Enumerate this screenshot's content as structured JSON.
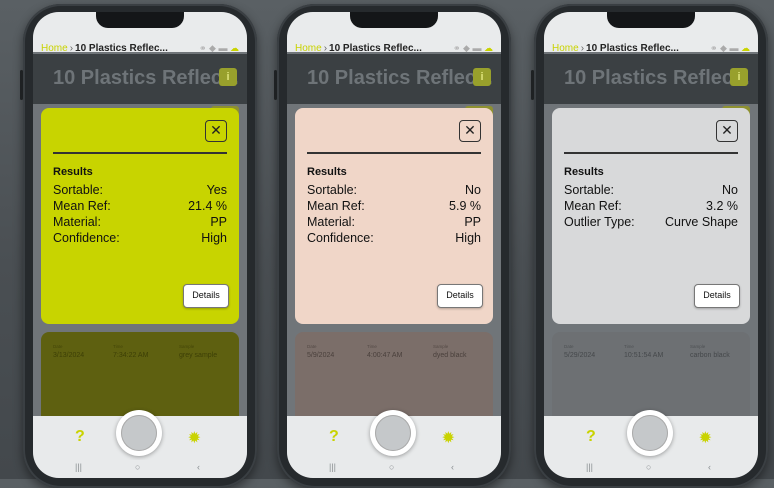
{
  "phones": [
    {
      "breadcrumb": {
        "home": "Home",
        "current": "10 Plastics Reflec..."
      },
      "header_title": "10 Plastics Reflec...",
      "info_label": "i",
      "close_label": "✕",
      "results_title": "Results",
      "rows": [
        {
          "label": "Sortable:",
          "value": "Yes"
        },
        {
          "label": "Mean Ref:",
          "value": "21.4 %"
        },
        {
          "label": "Material:",
          "value": "PP"
        },
        {
          "label": "Confidence:",
          "value": "High"
        }
      ],
      "details_label": "Details",
      "card_color": "#c8d400",
      "record_color": "#5e6010",
      "record": {
        "date_h": "Date",
        "time_h": "Time",
        "sample_h": "Sample",
        "date": "3/13/2024",
        "time": "7:34:22 AM",
        "sample": "grey sample"
      }
    },
    {
      "breadcrumb": {
        "home": "Home",
        "current": "10 Plastics Reflec..."
      },
      "header_title": "10 Plastics Reflec...",
      "info_label": "i",
      "close_label": "✕",
      "results_title": "Results",
      "rows": [
        {
          "label": "Sortable:",
          "value": "No"
        },
        {
          "label": "Mean Ref:",
          "value": "5.9 %"
        },
        {
          "label": "Material:",
          "value": "PP"
        },
        {
          "label": "Confidence:",
          "value": "High"
        }
      ],
      "details_label": "Details",
      "card_color": "#f0d6c8",
      "record_color": "#7b6e69",
      "record": {
        "date_h": "Date",
        "time_h": "Time",
        "sample_h": "Sample",
        "date": "5/9/2024",
        "time": "4:00:47 AM",
        "sample": "dyed black"
      }
    },
    {
      "breadcrumb": {
        "home": "Home",
        "current": "10 Plastics Reflec..."
      },
      "header_title": "10 Plastics Reflec...",
      "info_label": "i",
      "close_label": "✕",
      "results_title": "Results",
      "rows": [
        {
          "label": "Sortable:",
          "value": "No"
        },
        {
          "label": "Mean Ref:",
          "value": "3.2 %"
        },
        {
          "label": "Outlier Type:",
          "value": "Curve Shape"
        }
      ],
      "details_label": "Details",
      "card_color": "#d8d9da",
      "record_color": "#6d7073",
      "record": {
        "date_h": "Date",
        "time_h": "Time",
        "sample_h": "Sample",
        "date": "5/29/2024",
        "time": "10:51:54 AM",
        "sample": "carbon black"
      }
    }
  ],
  "bottom": {
    "help": "?",
    "gear": "✹"
  },
  "nav": {
    "recent": "|||",
    "home": "○",
    "back": "‹"
  },
  "icons": {
    "link": "link-icon",
    "wifi": "wifi-icon",
    "battery": "battery-icon",
    "cloud": "cloud-icon"
  }
}
